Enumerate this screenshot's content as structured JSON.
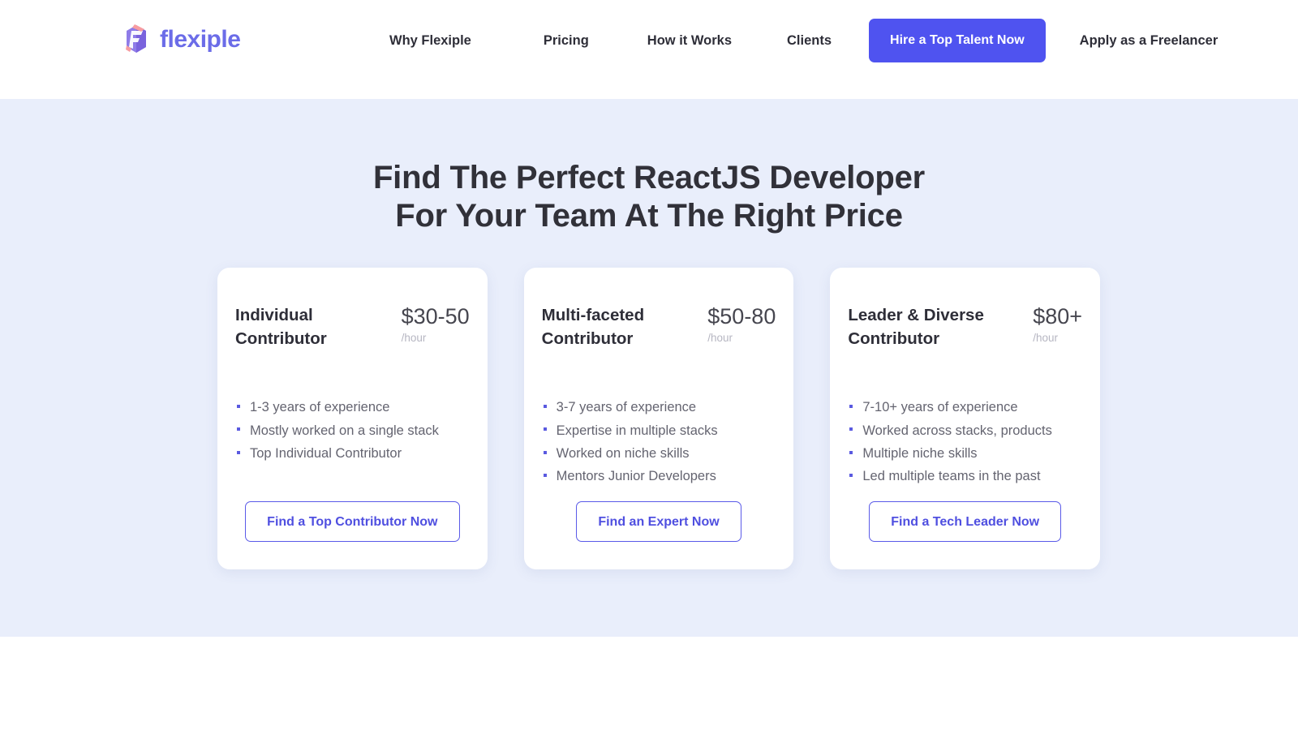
{
  "header": {
    "logo": {
      "icon": "flexiple-cube-logo-icon",
      "text": "flexiple",
      "color": "#6b6ce8"
    },
    "nav_items": [
      {
        "label": "Why Flexiple"
      },
      {
        "label": "Pricing"
      },
      {
        "label": "How it Works"
      },
      {
        "label": "Clients"
      }
    ],
    "cta_label": "Hire a Top Talent Now",
    "cta_color": "#4f53f0",
    "freelancer_link": "Apply as a Freelancer"
  },
  "hero": {
    "heading_line_1": "Find The Perfect ReactJS Developer",
    "heading_line_2": "For Your Team At The Right Price",
    "background_color": "#e9eefb"
  },
  "cards": [
    {
      "title": "Individual Contributor",
      "price": "$30-50",
      "price_unit": "/hour",
      "features": [
        "1-3 years of experience",
        "Mostly worked on a single stack",
        "Top Individual Contributor"
      ],
      "button_label": "Find a Top Contributor Now"
    },
    {
      "title": "Multi-faceted Contributor",
      "price": "$50-80",
      "price_unit": "/hour",
      "features": [
        "3-7 years of experience",
        "Expertise in multiple stacks",
        "Worked on niche skills",
        "Mentors Junior Developers"
      ],
      "button_label": "Find an Expert Now"
    },
    {
      "title": "Leader & Diverse Contributor",
      "price": "$80+",
      "price_unit": "/hour",
      "features": [
        "7-10+ years of experience",
        "Worked across stacks, products",
        "Multiple niche skills",
        "Led multiple teams in the past"
      ],
      "button_label": "Find a Tech Leader Now"
    }
  ],
  "theme": {
    "accent": "#4f53f0",
    "card_button_border": "#5a5ae8",
    "bullet_color": "#5a5ae0",
    "text_dark": "#2e2e38",
    "text_muted": "#646470"
  }
}
